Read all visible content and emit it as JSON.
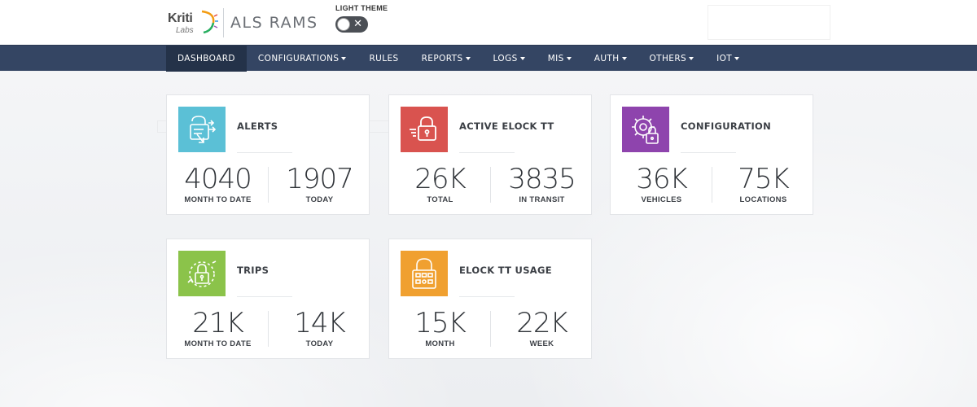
{
  "brand": {
    "logo_word": "Kriti",
    "logo_sub": "Labs",
    "app_title": "ALS RAMS"
  },
  "theme": {
    "label": "LIGHT THEME",
    "toggle_on": false
  },
  "nav": {
    "items": [
      {
        "label": "DASHBOARD",
        "active": true,
        "dropdown": false
      },
      {
        "label": "CONFIGURATIONS",
        "active": false,
        "dropdown": true
      },
      {
        "label": "RULES",
        "active": false,
        "dropdown": false
      },
      {
        "label": "REPORTS",
        "active": false,
        "dropdown": true
      },
      {
        "label": "LOGS",
        "active": false,
        "dropdown": true
      },
      {
        "label": "MIS",
        "active": false,
        "dropdown": true
      },
      {
        "label": "AUTH",
        "active": false,
        "dropdown": true
      },
      {
        "label": "OTHERS",
        "active": false,
        "dropdown": true
      },
      {
        "label": "IOT",
        "active": false,
        "dropdown": true
      }
    ]
  },
  "cards": [
    {
      "title": "ALERTS",
      "icon": "alert-shield-icon",
      "color": "#5bc0d6",
      "stats": [
        {
          "value": "4040",
          "label": "MONTH TO DATE"
        },
        {
          "value": "1907",
          "label": "TODAY"
        }
      ]
    },
    {
      "title": "ACTIVE ELOCK TT",
      "icon": "moving-lock-icon",
      "color": "#d9534f",
      "stats": [
        {
          "value": "26K",
          "label": "TOTAL"
        },
        {
          "value": "3835",
          "label": "IN TRANSIT"
        }
      ]
    },
    {
      "title": "CONFIGURATION",
      "icon": "gear-lock-icon",
      "color": "#8e44ad",
      "stats": [
        {
          "value": "36K",
          "label": "VEHICLES"
        },
        {
          "value": "75K",
          "label": "LOCATIONS"
        }
      ]
    },
    {
      "title": "TRIPS",
      "icon": "trip-lock-icon",
      "color": "#8bc34a",
      "stats": [
        {
          "value": "21K",
          "label": "MONTH TO DATE"
        },
        {
          "value": "14K",
          "label": "TODAY"
        }
      ]
    },
    {
      "title": "ELOCK TT USAGE",
      "icon": "elock-usage-icon",
      "color": "#f0a030",
      "stats": [
        {
          "value": "15K",
          "label": "MONTH"
        },
        {
          "value": "22K",
          "label": "WEEK"
        }
      ]
    }
  ]
}
